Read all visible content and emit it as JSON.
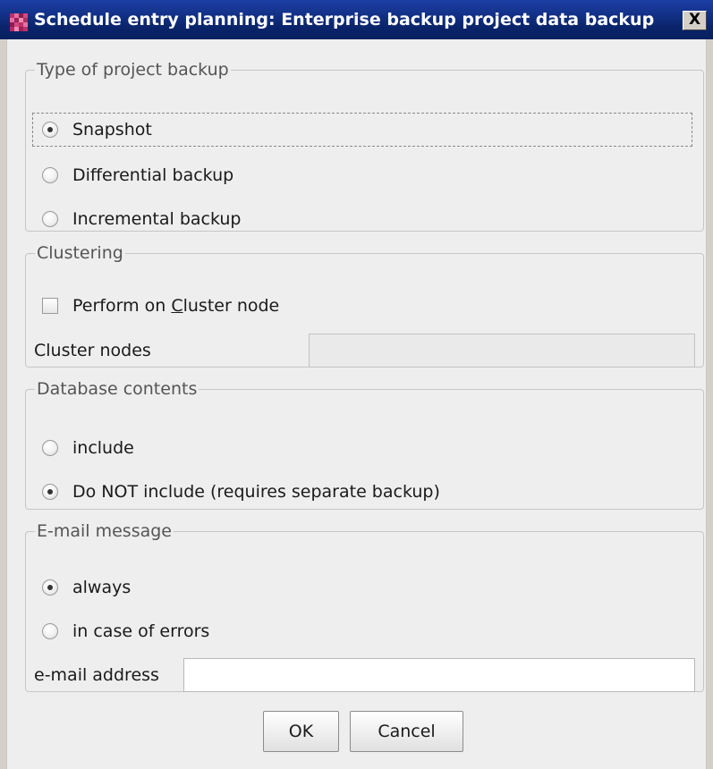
{
  "window": {
    "title": "Schedule entry planning: Enterprise backup project data backup",
    "close_label": "X"
  },
  "backup_type": {
    "legend": "Type of project backup",
    "options": [
      {
        "label": "Snapshot",
        "selected": true
      },
      {
        "label": "Differential backup",
        "selected": false
      },
      {
        "label": "Incremental backup",
        "selected": false
      }
    ]
  },
  "clustering": {
    "legend": "Clustering",
    "checkbox_prefix": "Perform on ",
    "checkbox_mnemonic": "C",
    "checkbox_suffix": "luster node",
    "checkbox_checked": false,
    "nodes_label": "Cluster nodes",
    "nodes_value": ""
  },
  "database": {
    "legend": "Database contents",
    "options": [
      {
        "label": "include",
        "selected": false
      },
      {
        "label": "Do NOT include (requires separate backup)",
        "selected": true
      }
    ]
  },
  "email": {
    "legend": "E-mail message",
    "options": [
      {
        "label": "always",
        "selected": true
      },
      {
        "label": "in case of errors",
        "selected": false
      }
    ],
    "address_label": "e-mail address",
    "address_value": ""
  },
  "buttons": {
    "ok": "OK",
    "cancel": "Cancel"
  }
}
